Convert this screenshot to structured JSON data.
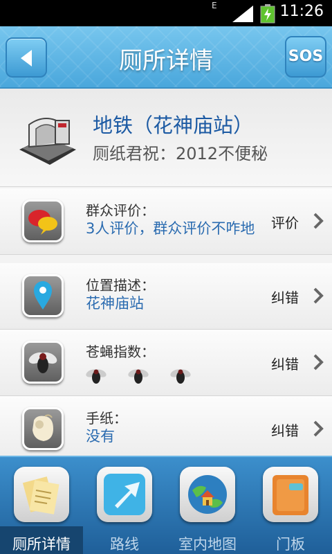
{
  "status_bar": {
    "time": "11:26",
    "network": "E"
  },
  "header": {
    "title": "厕所详情",
    "sos_label": "SOS"
  },
  "summary": {
    "name": "地铁（花神庙站）",
    "description": "厕纸君祝：2012不便秘"
  },
  "rows": [
    {
      "label": "群众评价：",
      "value": "3人评价，群众评价不咋地",
      "action": "评价"
    },
    {
      "label": "位置描述：",
      "value": "花神庙站",
      "action": "纠错"
    },
    {
      "label": "苍蝇指数：",
      "value": "",
      "action": "纠错",
      "fly_count": 3
    },
    {
      "label": "手纸：",
      "value": "没有",
      "action": "纠错"
    }
  ],
  "tabs": [
    {
      "label": "厕所详情",
      "active": true
    },
    {
      "label": "路线",
      "active": false
    },
    {
      "label": "室内地图",
      "active": false
    },
    {
      "label": "门板",
      "active": false
    }
  ],
  "colors": {
    "accent": "#4aa7dc",
    "link_text": "#2a6bb0",
    "title_text": "#1c5aa3"
  }
}
